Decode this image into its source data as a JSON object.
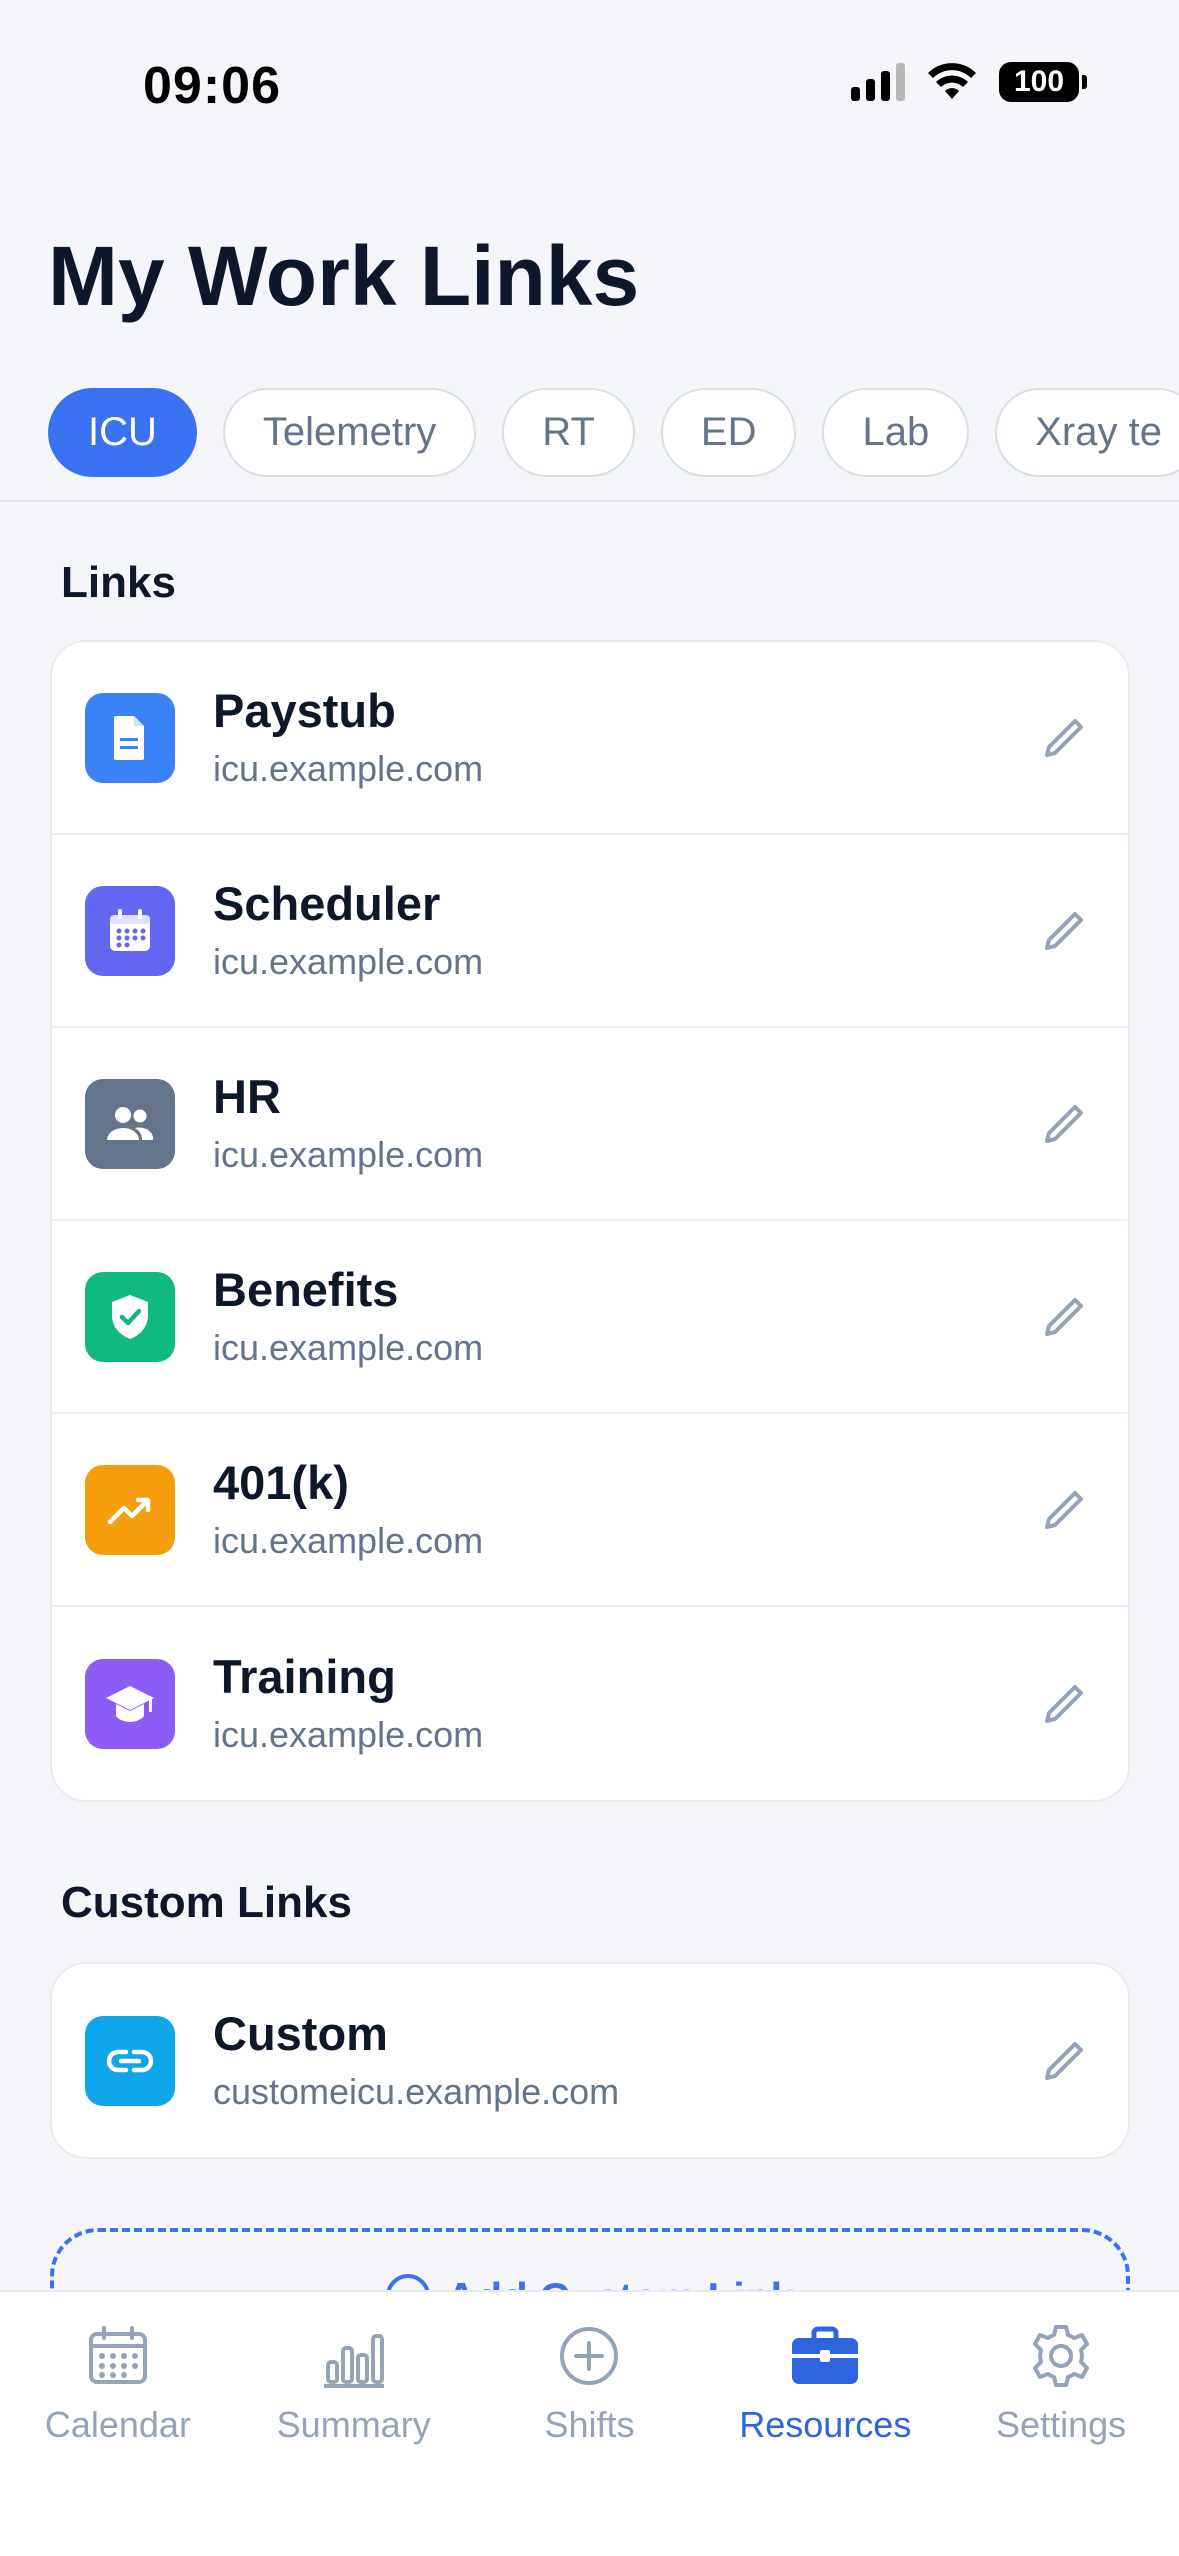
{
  "status_bar": {
    "time": "09:06",
    "battery": "100"
  },
  "page": {
    "title": "My Work Links"
  },
  "tabs": [
    {
      "label": "ICU",
      "active": true
    },
    {
      "label": "Telemetry",
      "active": false
    },
    {
      "label": "RT",
      "active": false
    },
    {
      "label": "ED",
      "active": false
    },
    {
      "label": "Lab",
      "active": false
    },
    {
      "label": "Xray te",
      "active": false
    }
  ],
  "links_section": {
    "title": "Links",
    "items": [
      {
        "title": "Paystub",
        "url": "icu.example.com",
        "icon": "document-icon",
        "color": "#3b82f6"
      },
      {
        "title": "Scheduler",
        "url": "icu.example.com",
        "icon": "calendar-icon",
        "color": "#6366f1"
      },
      {
        "title": "HR",
        "url": "icu.example.com",
        "icon": "people-icon",
        "color": "#64748b"
      },
      {
        "title": "Benefits",
        "url": "icu.example.com",
        "icon": "shield-check-icon",
        "color": "#10b981"
      },
      {
        "title": "401(k)",
        "url": "icu.example.com",
        "icon": "trending-up-icon",
        "color": "#f59e0b"
      },
      {
        "title": "Training",
        "url": "icu.example.com",
        "icon": "graduation-cap-icon",
        "color": "#8b5cf6"
      }
    ]
  },
  "custom_section": {
    "title": "Custom Links",
    "items": [
      {
        "title": "Custom",
        "url": "customeicu.example.com",
        "icon": "link-icon",
        "color": "#0ea5e9"
      }
    ],
    "add_button_label": "Add Custom Link"
  },
  "tab_bar": {
    "items": [
      {
        "label": "Calendar",
        "icon": "calendar-icon",
        "active": false
      },
      {
        "label": "Summary",
        "icon": "bar-chart-icon",
        "active": false
      },
      {
        "label": "Shifts",
        "icon": "plus-circle-icon",
        "active": false
      },
      {
        "label": "Resources",
        "icon": "briefcase-icon",
        "active": true
      },
      {
        "label": "Settings",
        "icon": "gear-icon",
        "active": false
      }
    ]
  },
  "colors": {
    "accent": "#3b71f3",
    "text": "#0f172a",
    "muted": "#64748b",
    "background": "#f4f6fa"
  }
}
